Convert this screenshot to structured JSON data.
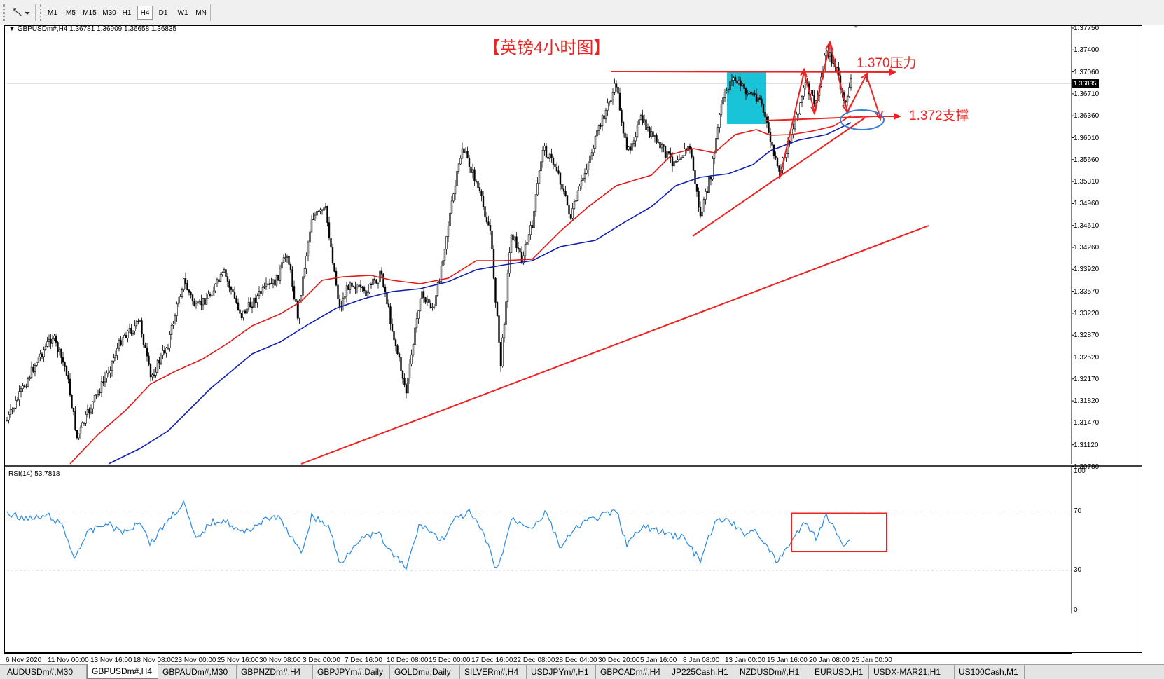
{
  "toolbar": {
    "timeframes": [
      "M1",
      "M5",
      "M15",
      "M30",
      "H1",
      "H4",
      "D1",
      "W1",
      "MN"
    ],
    "active_timeframe": "H4"
  },
  "chart": {
    "info": "GBPUSDm#,H4  1.36781 1.36909 1.36658 1.36835",
    "title": "【英镑4小时图】",
    "current_price": "1.36835",
    "annotation_resistance": "1.370压力",
    "annotation_support": "1.372支撑",
    "price_labels": [
      "1.37750",
      "1.37400",
      "1.37060",
      "1.36710",
      "1.36360",
      "1.36010",
      "1.35660",
      "1.35310",
      "1.34960",
      "1.34610",
      "1.34260",
      "1.33920",
      "1.33570",
      "1.33220",
      "1.32870",
      "1.32520",
      "1.32170",
      "1.31820",
      "1.31470",
      "1.31120",
      "1.30780"
    ],
    "colors": {
      "bull": "#000000",
      "ma_fast": "#e51717",
      "ma_slow": "#0f1fb0",
      "annotation": "#ee2222",
      "box": "#00bcd4",
      "ellipse": "#3a7fd5",
      "rsi": "#2b8be6"
    }
  },
  "rsi": {
    "label": "RSI(14) 53.7818",
    "levels": [
      "100",
      "70",
      "30",
      "0"
    ]
  },
  "time_axis": {
    "labels": [
      "6 Nov 2020",
      "11 Nov 00:00",
      "13 Nov 16:00",
      "18 Nov 08:00",
      "23 Nov 00:00",
      "25 Nov 16:00",
      "30 Nov 08:00",
      "3 Dec 00:00",
      "7 Dec 16:00",
      "10 Dec 08:00",
      "15 Dec 00:00",
      "17 Dec 16:00",
      "22 Dec 08:00",
      "28 Dec 04:00",
      "30 Dec 20:00",
      "5 Jan 16:00",
      "8 Jan 08:00",
      "13 Jan 00:00",
      "15 Jan 16:00",
      "20 Jan 08:00",
      "25 Jan 00:00"
    ]
  },
  "tabs": [
    "AUDUSDm#,M30",
    "GBPUSDm#,H4",
    "GBPAUDm#,M30",
    "GBPNZDm#,H4",
    "GBPJPYm#,Daily",
    "GOLDm#,Daily",
    "SILVERm#,H4",
    "USDJPYm#,H1",
    "GBPCADm#,H4",
    "JP225Cash,H1",
    "NZDUSDm#,H1",
    "EURUSD,H1",
    "USDX-MAR21,H1",
    "US100Cash,M1"
  ],
  "active_tab": "GBPUSDm#,H4"
}
